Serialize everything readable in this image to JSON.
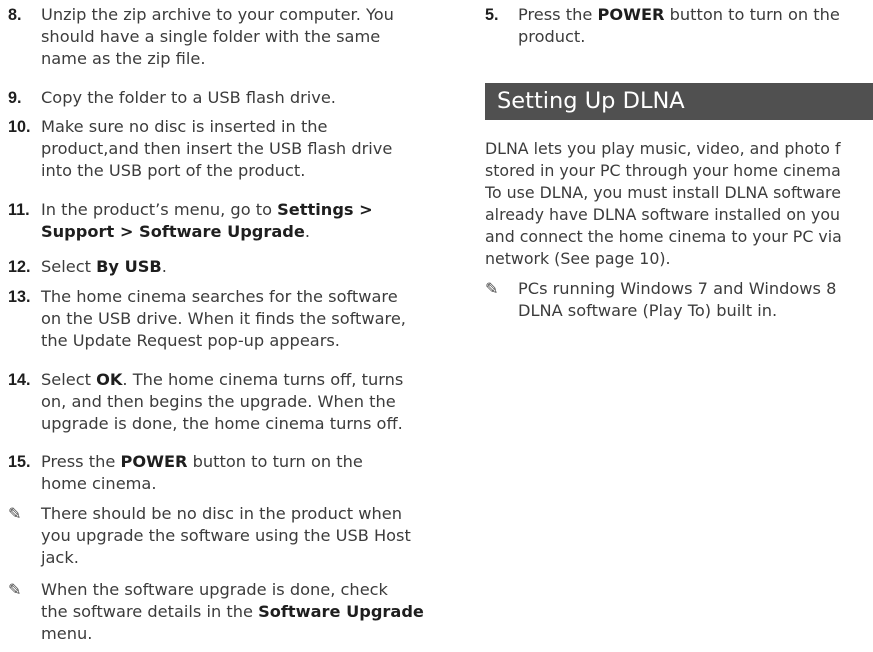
{
  "left": {
    "steps": [
      {
        "num": "8.",
        "lines": [
          "Unzip the zip archive to your computer. You",
          "should have a single folder with the same",
          "name as the zip file."
        ]
      },
      {
        "num": "9.",
        "lines": [
          "Copy the folder to a USB flash drive."
        ]
      },
      {
        "num": "10.",
        "lines": [
          "Make sure no disc is inserted in the",
          "product,and then insert the USB flash drive",
          "into the USB port of the product."
        ]
      },
      {
        "num": "11.",
        "l1_pre": "In the product’s menu, go to ",
        "l1_bold": "Settings >",
        "l2_bold": "Support > Software Upgrade",
        "l2_post": "."
      },
      {
        "num": "12.",
        "pre": "Select ",
        "bold": "By USB",
        "post": "."
      },
      {
        "num": "13.",
        "lines": [
          "The home cinema searches for the software",
          "on the USB drive. When it finds the software,",
          "the Update Request pop-up appears."
        ]
      },
      {
        "num": "14.",
        "l1_pre": "Select ",
        "l1_bold": "OK",
        "l1_post": ". The home cinema turns off, turns",
        "l2": "on, and then begins the upgrade. When the",
        "l3": "upgrade is done, the home cinema turns off."
      },
      {
        "num": "15.",
        "l1_pre": "Press the ",
        "l1_bold": "POWER",
        "l1_post": " button to turn on the",
        "l2": "home cinema."
      }
    ],
    "notes": [
      {
        "icon": "✎",
        "lines": [
          "There should be no disc in the product when",
          "you upgrade the software using the USB Host",
          "jack."
        ]
      },
      {
        "icon": "✎",
        "l1": "When the software upgrade is done, check",
        "l2_pre": "the software details in the ",
        "l2_bold": "Software Upgrade",
        "l3": "menu."
      }
    ]
  },
  "right": {
    "step5": {
      "num": "5.",
      "l1_pre": "Press the ",
      "l1_bold": "POWER",
      "l1_post": " button to turn on the",
      "l2": "product."
    },
    "heading": "Setting Up DLNA",
    "para": [
      "DLNA lets you play music, video, and photo f",
      "stored in your PC through your home cinema",
      "To use DLNA, you must install DLNA software",
      "already have DLNA software installed on you",
      "and connect the home cinema to your PC via",
      "network (See page 10)."
    ],
    "note": {
      "icon": "✎",
      "lines": [
        "PCs running Windows 7 and Windows 8",
        "DLNA software (Play To) built in."
      ]
    }
  }
}
